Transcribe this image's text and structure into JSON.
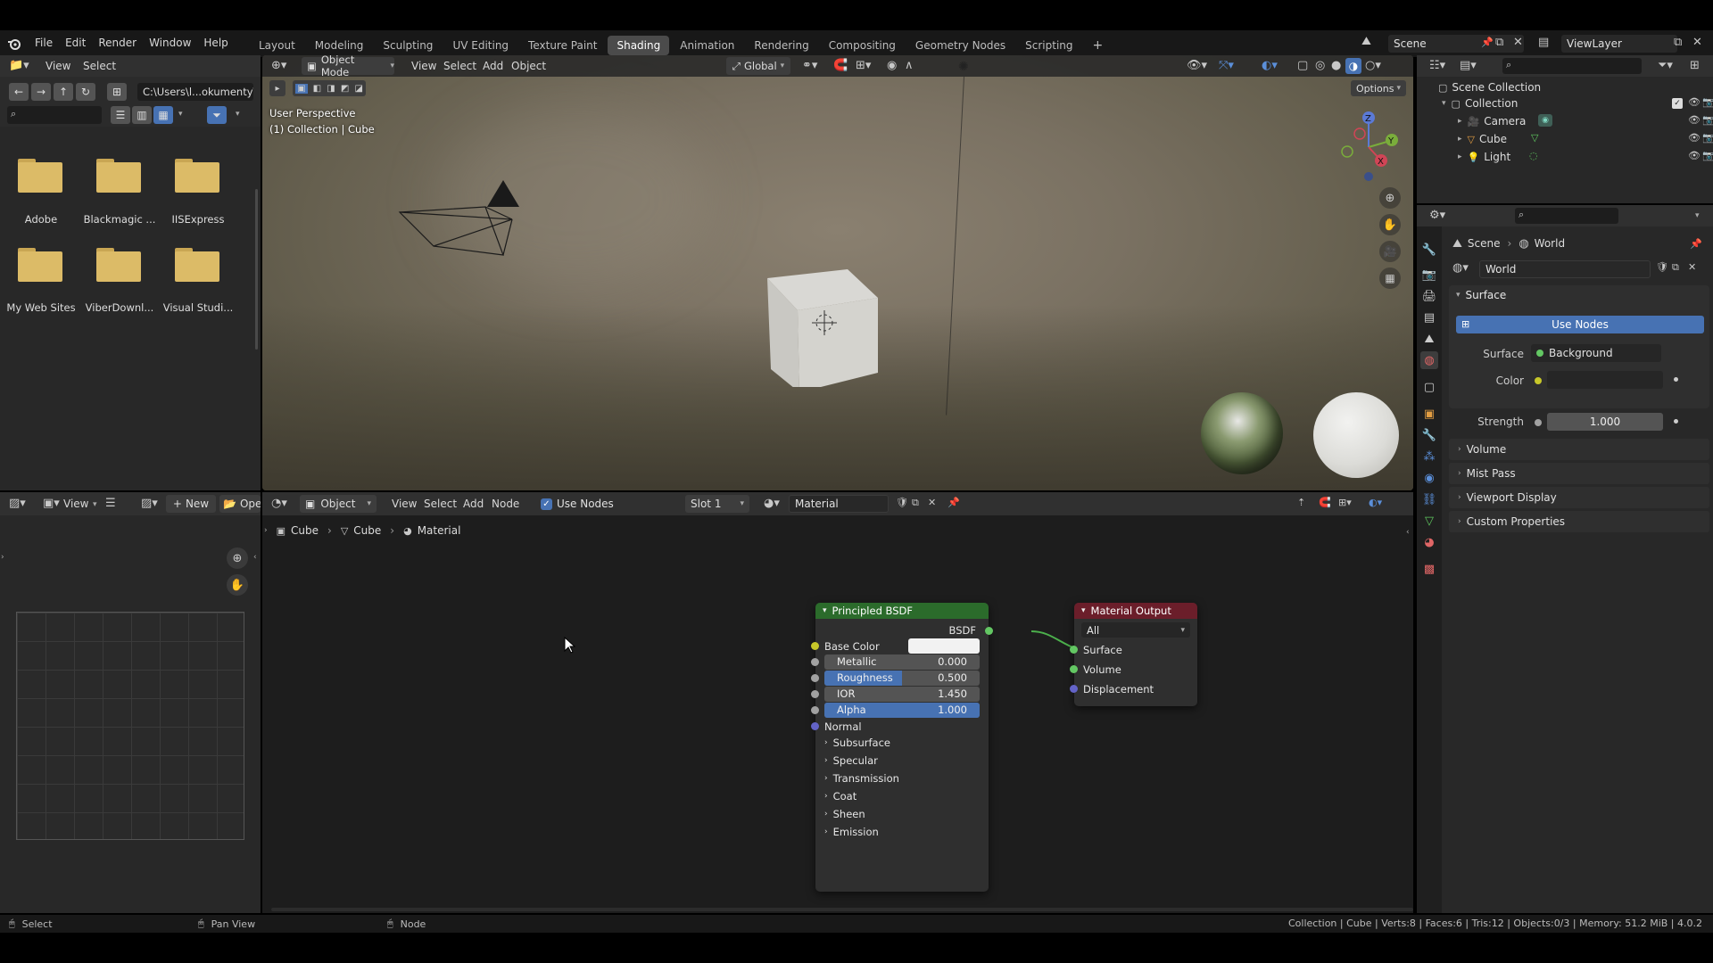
{
  "menubar": {
    "menus": [
      "File",
      "Edit",
      "Render",
      "Window",
      "Help"
    ],
    "workspaces": [
      "Layout",
      "Modeling",
      "Sculpting",
      "UV Editing",
      "Texture Paint",
      "Shading",
      "Animation",
      "Rendering",
      "Compositing",
      "Geometry Nodes",
      "Scripting"
    ],
    "active_workspace": "Shading",
    "add_tab": "+",
    "scene_name": "Scene",
    "view_layer": "ViewLayer"
  },
  "file_browser": {
    "menus": [
      "View",
      "Select"
    ],
    "path": "C:\\Users\\l...okumenty\\",
    "folders": [
      {
        "name": "Adobe"
      },
      {
        "name": "Blackmagic ..."
      },
      {
        "name": "IISExpress"
      },
      {
        "name": "My Web Sites"
      },
      {
        "name": "ViberDownl..."
      },
      {
        "name": "Visual Studi..."
      }
    ]
  },
  "viewport": {
    "mode": "Object Mode",
    "menus": [
      "View",
      "Select",
      "Add",
      "Object"
    ],
    "transform": "Global",
    "options": "Options",
    "overlay_line1": "User Perspective",
    "overlay_line2": "(1) Collection | Cube",
    "gizmo": {
      "x": "X",
      "y": "Y",
      "z": "Z"
    }
  },
  "outliner": {
    "root": "Scene Collection",
    "collection": "Collection",
    "items": [
      "Camera",
      "Cube",
      "Light"
    ]
  },
  "properties": {
    "breadcrumb_scene": "Scene",
    "breadcrumb_world": "World",
    "world_name": "World",
    "surface_panel": "Surface",
    "use_nodes": "Use Nodes",
    "surface_label": "Surface",
    "surface_value": "Background",
    "color_label": "Color",
    "strength_label": "Strength",
    "strength_value": "1.000",
    "panels": [
      "Volume",
      "Mist Pass",
      "Viewport Display",
      "Custom Properties"
    ]
  },
  "image_editor": {
    "view": "View",
    "new": "New",
    "open": "Ope"
  },
  "node_editor": {
    "mode": "Object",
    "menus": [
      "View",
      "Select",
      "Add",
      "Node"
    ],
    "use_nodes": "Use Nodes",
    "slot": "Slot 1",
    "material": "Material",
    "breadcrumb": [
      "Cube",
      "Cube",
      "Material"
    ],
    "bsdf": {
      "title": "Principled BSDF",
      "output": "BSDF",
      "base_color": "Base Color",
      "metallic": {
        "label": "Metallic",
        "value": "0.000",
        "fraction": 0.0
      },
      "roughness": {
        "label": "Roughness",
        "value": "0.500",
        "fraction": 0.5
      },
      "ior": {
        "label": "IOR",
        "value": "1.450",
        "fraction": 0.0
      },
      "alpha": {
        "label": "Alpha",
        "value": "1.000",
        "fraction": 1.0
      },
      "normal": "Normal",
      "sections": [
        "Subsurface",
        "Specular",
        "Transmission",
        "Coat",
        "Sheen",
        "Emission"
      ]
    },
    "output": {
      "title": "Material Output",
      "target": "All",
      "inputs": [
        "Surface",
        "Volume",
        "Displacement"
      ]
    }
  },
  "statusbar": {
    "select": "Select",
    "pan": "Pan View",
    "node": "Node",
    "stats": "Collection | Cube | Verts:8 | Faces:6 | Tris:12 | Objects:0/3 | Memory: 51.2 MiB | 4.0.2"
  },
  "colors": {
    "accent": "#4772b3",
    "bsdf_header": "#2b6b2b",
    "output_header": "#6b1e2a",
    "socket_yellow": "#c7c729",
    "socket_grey": "#a1a1a1",
    "socket_blue": "#6363c7",
    "socket_green": "#63c763"
  }
}
